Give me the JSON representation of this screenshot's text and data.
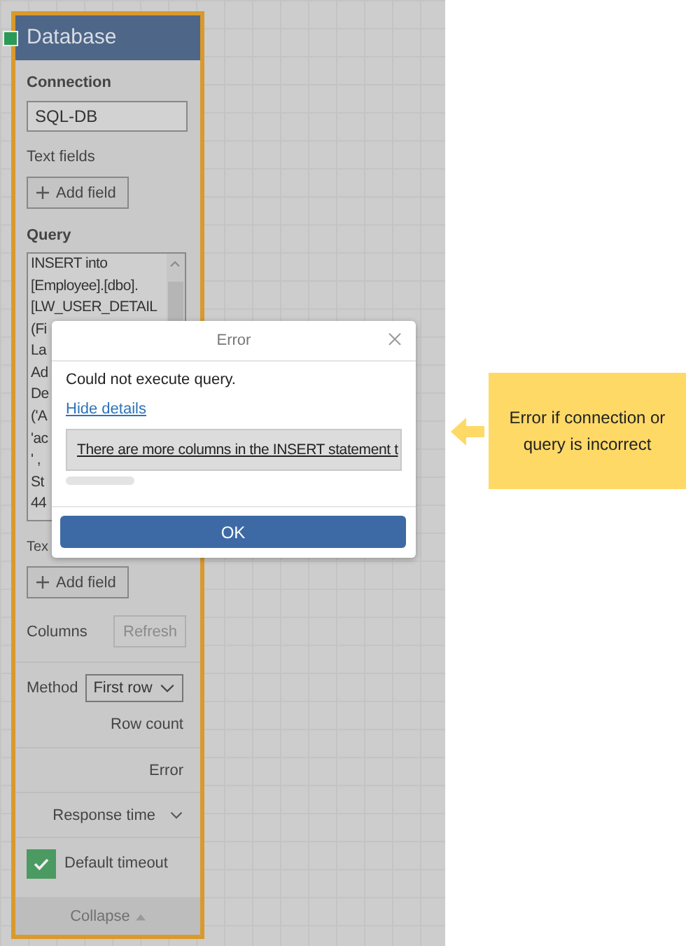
{
  "panel": {
    "title": "Database",
    "connection": {
      "label": "Connection",
      "value": "SQL-DB"
    },
    "text_fields": {
      "label": "Text fields",
      "button": "Add field"
    },
    "query": {
      "label": "Query",
      "lines": [
        "INSERT into",
        "[Employee].[dbo].",
        "[LW_USER_DETAIL",
        "(Fi",
        "La",
        "Ad",
        "De",
        "('A",
        "'ac",
        "' ,",
        "St",
        "44"
      ]
    },
    "text_fields_2": {
      "label": "Tex",
      "button": "Add field"
    },
    "columns": {
      "label": "Columns",
      "button": "Refresh",
      "disabled": true
    },
    "method": {
      "label": "Method",
      "value": "First row"
    },
    "outputs": [
      {
        "label": "Row count"
      },
      {
        "label": "Error"
      },
      {
        "label": "Response time",
        "expanded": false
      }
    ],
    "default_timeout": {
      "label": "Default timeout",
      "checked": true
    },
    "collapse": "Collapse"
  },
  "dialog": {
    "title": "Error",
    "message": "Could not execute query.",
    "link": "Hide details",
    "detail": "There are more columns in the INSERT statement t",
    "button": "OK"
  },
  "callout": {
    "text": "Error if connection or query is incorrect"
  }
}
